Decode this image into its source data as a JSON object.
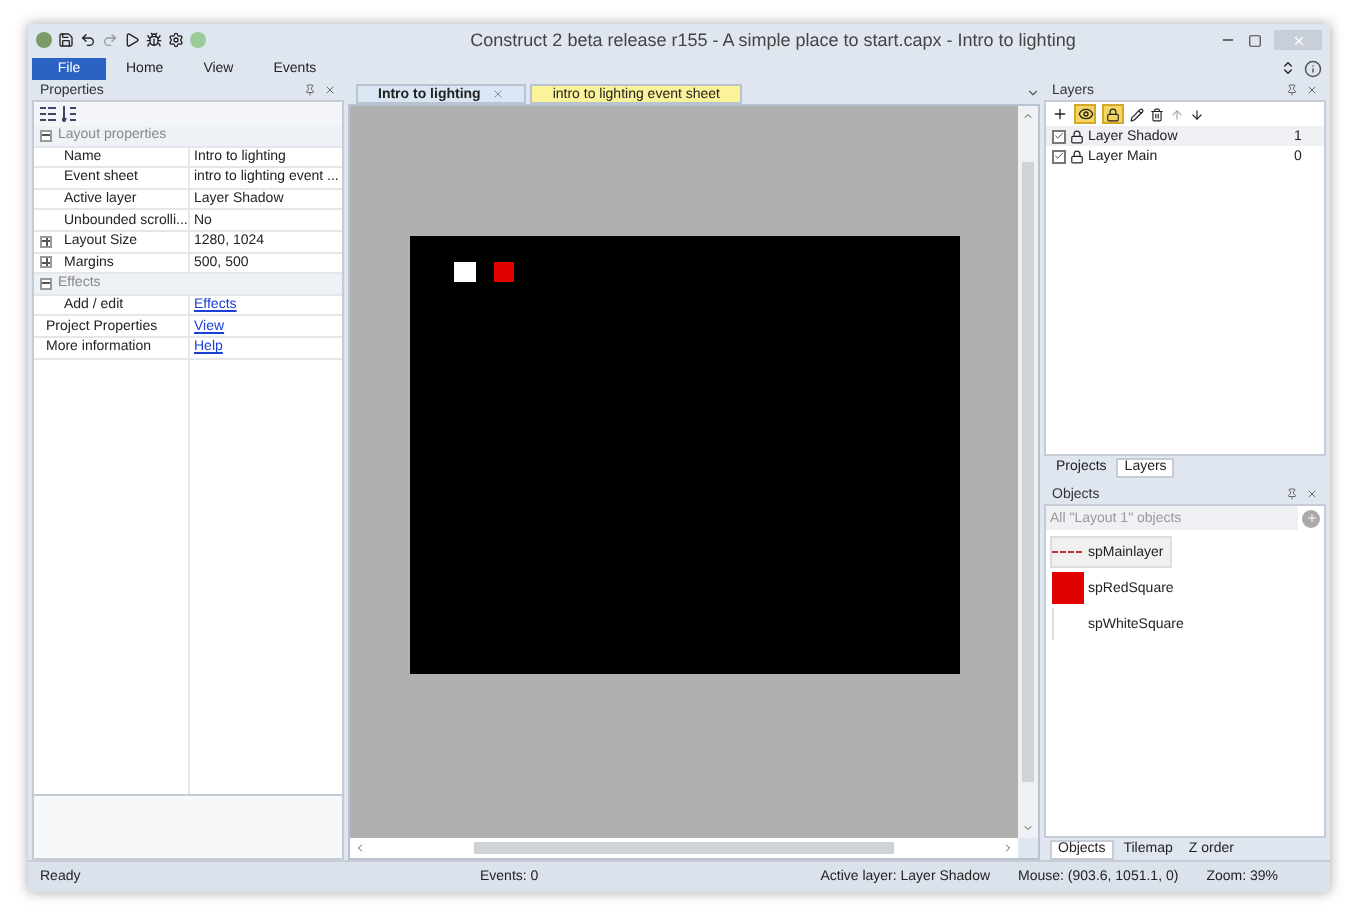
{
  "window": {
    "title": "Construct 2 beta release r155 - A simple place to start.capx - Intro to lighting"
  },
  "ribbon": {
    "file_button": "File",
    "tabs": [
      {
        "label": "Home",
        "selected": false
      },
      {
        "label": "View",
        "selected": false
      },
      {
        "label": "Events",
        "selected": false
      }
    ]
  },
  "properties": {
    "title": "Properties",
    "rows": [
      {
        "kind": "section",
        "label": "Layout properties",
        "expanded": true
      },
      {
        "kind": "property",
        "label": "Name",
        "value": "Intro to lighting"
      },
      {
        "kind": "property",
        "label": "Event sheet",
        "value": "intro to lighting event ..."
      },
      {
        "kind": "property",
        "label": "Active layer",
        "value": "Layer Shadow"
      },
      {
        "kind": "property",
        "label": "Unbounded scrolli...",
        "value": "No"
      },
      {
        "kind": "property",
        "label": "Layout Size",
        "value": "1280, 1024",
        "expanded": false
      },
      {
        "kind": "property",
        "label": "Margins",
        "value": "500, 500",
        "expanded": false
      },
      {
        "kind": "section",
        "label": "Effects",
        "expanded": true
      },
      {
        "kind": "property",
        "label": "Add / edit",
        "value": "Effects",
        "link": true
      },
      {
        "kind": "top",
        "label": "Project Properties",
        "value": "View",
        "link": true
      },
      {
        "kind": "top",
        "label": "More information",
        "value": "Help",
        "link": true
      }
    ]
  },
  "editor_tabs": [
    {
      "label": "Intro to lighting",
      "kind": "layout",
      "selected": true
    },
    {
      "label": "intro to lighting event sheet",
      "kind": "event_sheet",
      "selected": false
    }
  ],
  "layers": {
    "title": "Layers",
    "eye_on": true,
    "lock_on": true,
    "items": [
      {
        "name": "Layer Shadow",
        "index": "1",
        "checked": true,
        "selected": true
      },
      {
        "name": "Layer Main",
        "index": "0",
        "checked": true,
        "selected": false
      }
    ],
    "tabs": [
      {
        "label": "Projects",
        "selected": false
      },
      {
        "label": "Layers",
        "selected": true
      }
    ]
  },
  "objects": {
    "title": "Objects",
    "placeholder": "All \"Layout 1\" objects",
    "items": [
      {
        "name": "spMainlayer",
        "kind": "line",
        "selected": true
      },
      {
        "name": "spRedSquare",
        "kind": "red",
        "selected": false
      },
      {
        "name": "spWhiteSquare",
        "kind": "white",
        "selected": false
      }
    ],
    "tabs": [
      {
        "label": "Objects",
        "selected": true
      },
      {
        "label": "Tilemap",
        "selected": false
      },
      {
        "label": "Z order",
        "selected": false
      }
    ]
  },
  "status_bar": {
    "state": "Ready",
    "events": "Events: 0",
    "active_layer": "Active layer: Layer Shadow",
    "mouse": "Mouse: (903.6, 1051.1, 0)",
    "zoom": "Zoom: 39%"
  }
}
